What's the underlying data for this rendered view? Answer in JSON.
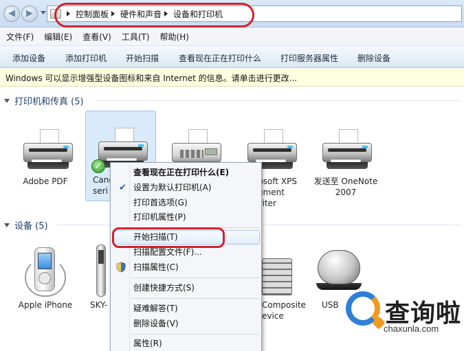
{
  "address": {
    "breadcrumbs": [
      "控制面板",
      "硬件和声音",
      "设备和打印机"
    ]
  },
  "menubar": [
    "文件(F)",
    "编辑(E)",
    "查看(V)",
    "工具(T)",
    "帮助(H)"
  ],
  "commands": [
    "添加设备",
    "添加打印机",
    "开始扫描",
    "查看现在正在打印什么",
    "打印服务器属性",
    "删除设备"
  ],
  "infobar": "Windows 可以显示增强型设备图标和来自 Internet 的信息。请单击进行更改...",
  "printers_group": {
    "title": "打印机和传真 (5)",
    "items": [
      {
        "line1": "Adobe PDF",
        "line2": ""
      },
      {
        "line1": "Canc",
        "line2": "seri"
      },
      {
        "line1": "",
        "line2": ""
      },
      {
        "line1": "osoft XPS",
        "line2": "cument",
        "line3": "Writer"
      },
      {
        "line1": "发送至 OneNote",
        "line2": "2007"
      }
    ]
  },
  "devices_group": {
    "title": "设备 (5)",
    "items": [
      {
        "line1": "Apple iPhone"
      },
      {
        "line1": "SKY-"
      },
      {
        "line1": "Composite",
        "line2": "evice"
      },
      {
        "line1": "USB"
      }
    ]
  },
  "context_menu": {
    "items": [
      {
        "label": "查看现在正在打印什么(E)",
        "bold": true
      },
      {
        "label": "设置为默认打印机(A)",
        "checked": true
      },
      {
        "label": "打印首选项(G)"
      },
      {
        "label": "打印机属性(P)"
      },
      {
        "label": "开始扫描(T)",
        "highlighted": true
      },
      {
        "label": "扫描配置文件(F)..."
      },
      {
        "label": "扫描属性(C)",
        "shield": true
      },
      {
        "label": "创建快捷方式(S)"
      },
      {
        "label": "疑难解答(T)"
      },
      {
        "label": "删除设备(V)"
      },
      {
        "label": "属性(R)"
      }
    ]
  },
  "watermark": {
    "brand": "查询啦",
    "url": "chaxunla.com"
  },
  "colors": {
    "annotation_red": "#d2202a",
    "group_header": "#1e3f6e",
    "info_bg": "#ffffe1",
    "watermark_blue": "#2e7fd8",
    "watermark_orange": "#f29a1d"
  }
}
